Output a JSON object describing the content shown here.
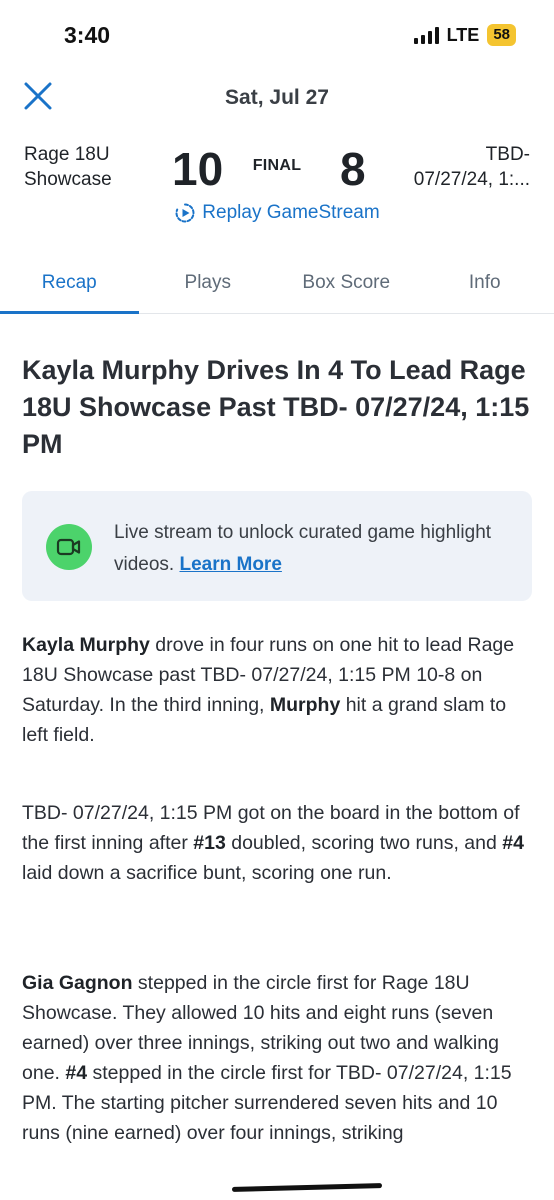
{
  "status_bar": {
    "time": "3:40",
    "network": "LTE",
    "battery": "58"
  },
  "header": {
    "date": "Sat, Jul 27",
    "close_icon": "close-icon",
    "home_team": "Rage 18U Showcase",
    "home_team_line1": "Rage 18U",
    "home_team_line2": "Showcase",
    "home_score": "10",
    "status": "FINAL",
    "away_score": "8",
    "away_team_line1": "TBD-",
    "away_team_line2": "07/27/24, 1:...",
    "replay_label": "Replay GameStream",
    "replay_icon": "replay-icon"
  },
  "tabs": [
    {
      "label": "Recap",
      "active": true
    },
    {
      "label": "Plays",
      "active": false
    },
    {
      "label": "Box Score",
      "active": false
    },
    {
      "label": "Info",
      "active": false
    }
  ],
  "article": {
    "title": "Kayla Murphy Drives In 4 To Lead Rage 18U Showcase Past TBD- 07/27/24, 1:15 PM",
    "promo": {
      "icon": "video-camera-icon",
      "text": "Live stream to unlock curated game highlight videos.",
      "link": "Learn More"
    },
    "paragraphs": [
      {
        "p1_bold1": "Kayla Murphy",
        "p1_text1": " drove in four runs on one hit to lead Rage 18U Showcase past TBD- 07/27/24, 1:15 PM 10-8 on Saturday. In the third inning, ",
        "p1_bold2": "Murphy",
        "p1_text2": " hit a grand slam to left field."
      },
      {
        "p2_text1": "TBD- 07/27/24, 1:15 PM got on the board in the bottom of the first inning after ",
        "p2_bold1": "#13",
        "p2_text2": " doubled, scoring two runs, and ",
        "p2_bold2": "#4",
        "p2_text3": " laid down a sacrifice bunt, scoring one run."
      },
      {
        "p3_bold1": "Gia Gagnon",
        "p3_text1": " stepped in the circle first for Rage 18U Showcase. They allowed 10 hits and eight runs (seven earned) over three innings, striking out two and walking one. ",
        "p3_bold2": "#4",
        "p3_text2": " stepped in the circle first for TBD- 07/27/24, 1:15 PM. The starting pitcher surrendered seven hits and 10 runs (nine earned) over four innings, striking"
      }
    ]
  },
  "colors": {
    "accent": "#1a73c8",
    "promo_bg": "#eef2f8",
    "promo_icon": "#4cd36b",
    "battery": "#f4c430"
  }
}
